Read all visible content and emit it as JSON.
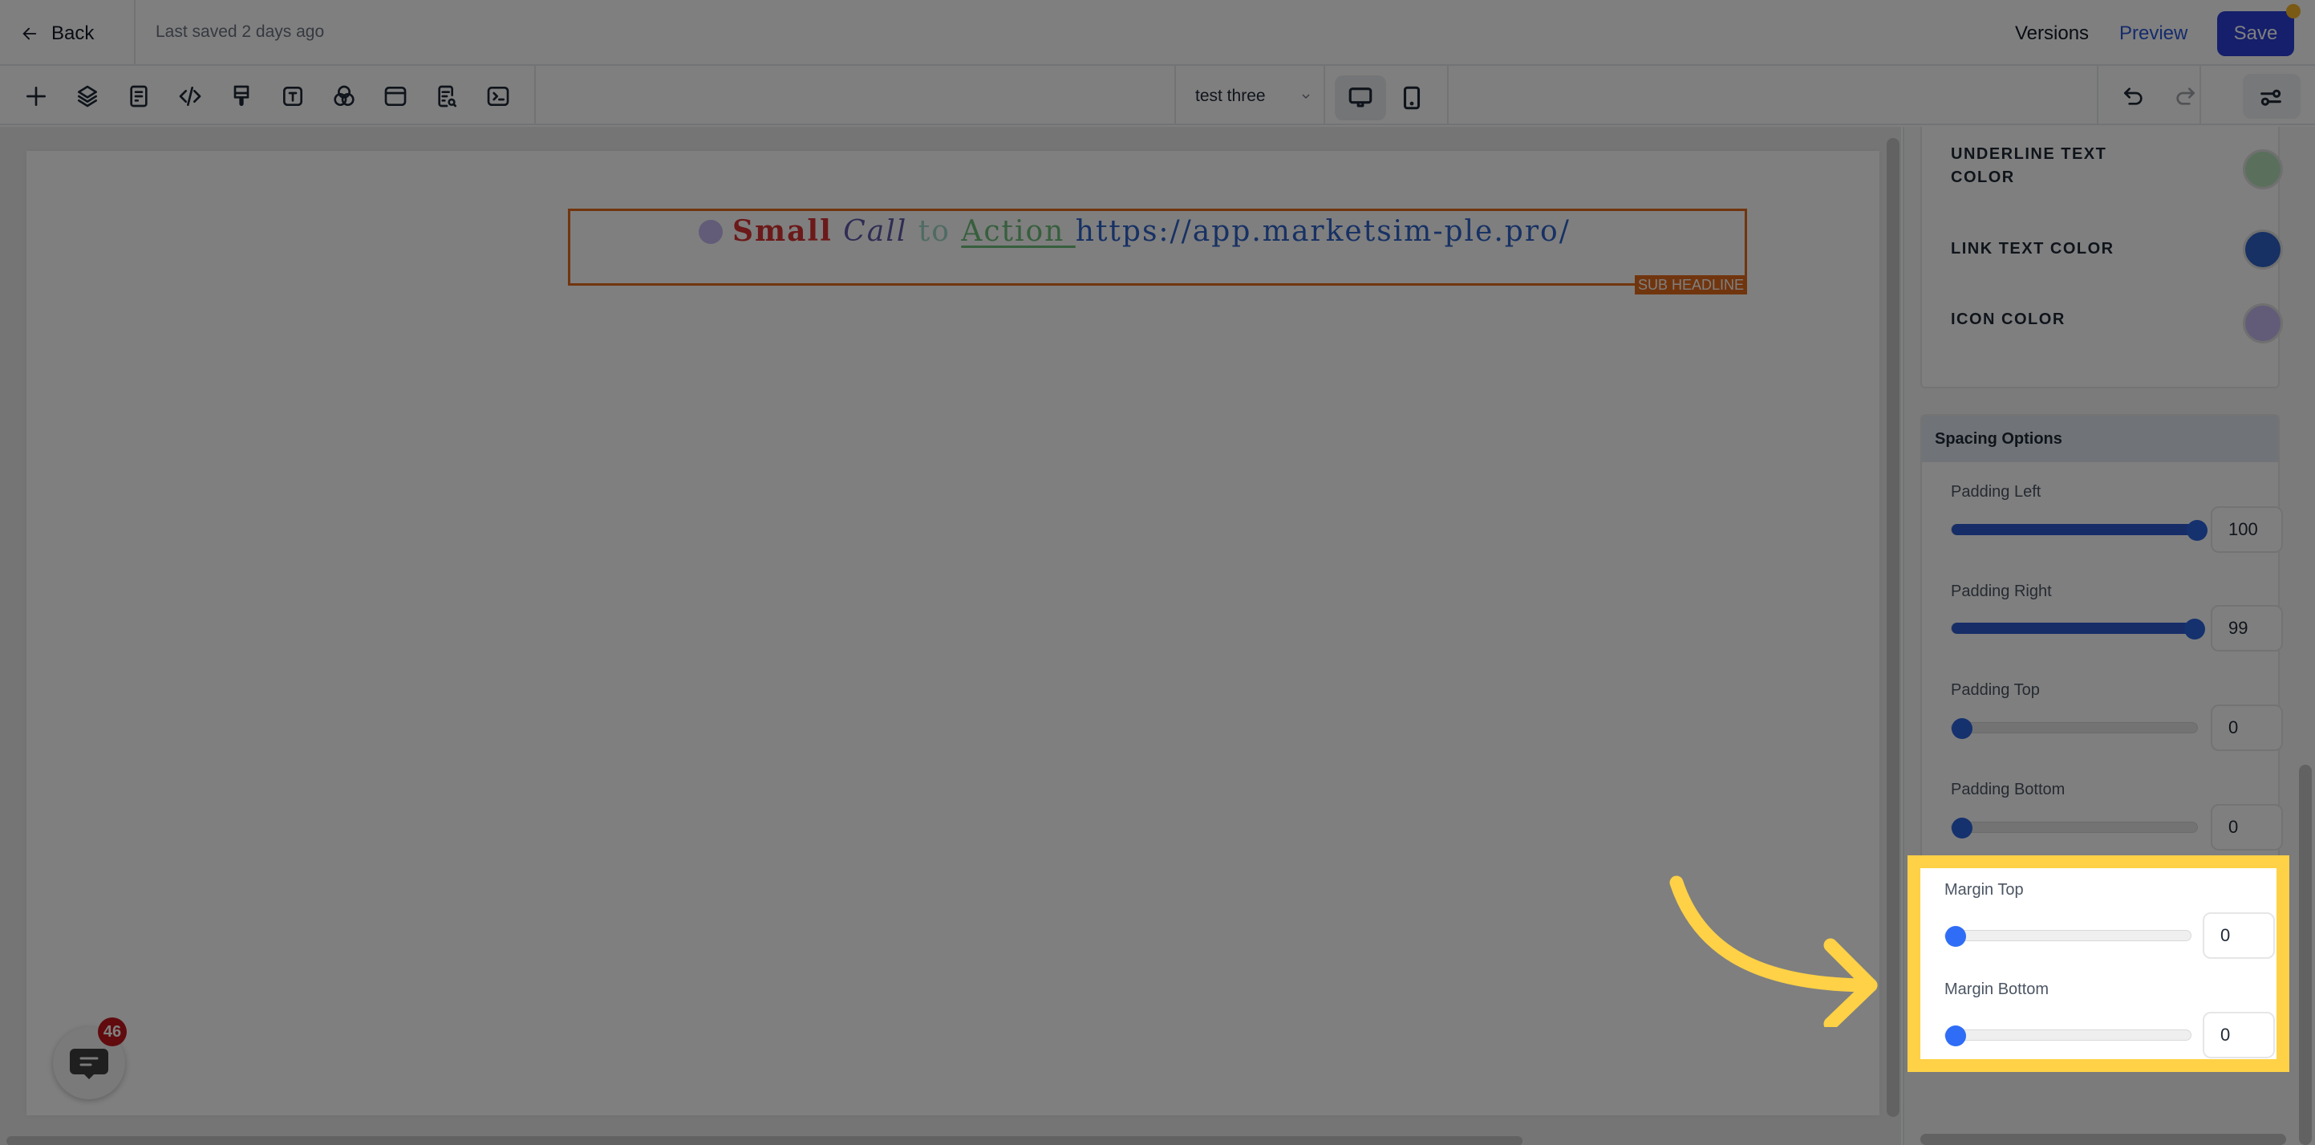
{
  "header": {
    "back_label": "Back",
    "last_saved": "Last saved 2 days ago",
    "versions_label": "Versions",
    "preview_label": "Preview",
    "save_label": "Save"
  },
  "toolbar": {
    "tools": [
      "add",
      "layers",
      "pages",
      "code",
      "styles",
      "text",
      "colors",
      "sections",
      "seo",
      "custom-js"
    ],
    "page_select": {
      "value": "test three"
    },
    "devices": [
      {
        "name": "desktop",
        "active": true
      },
      {
        "name": "mobile",
        "active": false
      }
    ],
    "undo_enabled": true,
    "redo_enabled": false
  },
  "canvas": {
    "headline": {
      "parts": {
        "small": "Small",
        "call": "Call",
        "to": "to",
        "action": "Action ",
        "link": "https://app.marketsim-ple.pro/"
      },
      "tag": "SUB HEADLINE"
    },
    "chat_badge_count": "46"
  },
  "panel": {
    "colors": [
      {
        "label": "UNDERLINE TEXT COLOR",
        "color": "#b5e0b8"
      },
      {
        "label": "LINK TEXT COLOR",
        "color": "#2e62c9"
      },
      {
        "label": "ICON COLOR",
        "color": "#c5b8f0"
      }
    ],
    "spacing": {
      "title": "Spacing Options",
      "fields": [
        {
          "label": "Padding Left",
          "value": "100",
          "fraction": 1.0
        },
        {
          "label": "Padding Right",
          "value": "99",
          "fraction": 0.99
        },
        {
          "label": "Padding Top",
          "value": "0",
          "fraction": 0
        },
        {
          "label": "Padding Bottom",
          "value": "0",
          "fraction": 0
        },
        {
          "label": "Margin Top",
          "value": "0",
          "fraction": 0
        },
        {
          "label": "Margin Bottom",
          "value": "0",
          "fraction": 0
        }
      ]
    }
  },
  "annotation": {
    "highlight_color": "#fed146"
  }
}
